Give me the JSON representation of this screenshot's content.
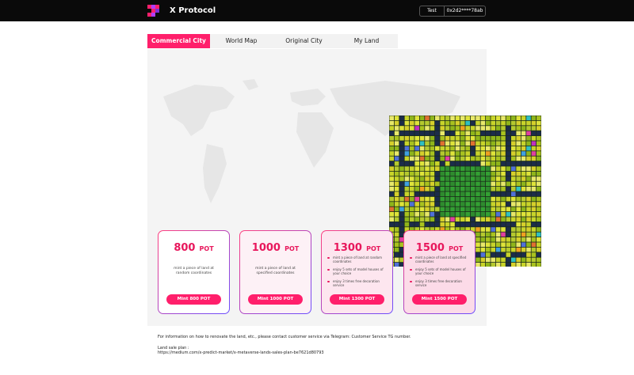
{
  "header": {
    "brand": "X Protocol",
    "network_label": "Test",
    "wallet_address": "0x2d2****78ab"
  },
  "tabs": [
    {
      "label": "Commercial City",
      "active": true
    },
    {
      "label": "World Map",
      "active": false
    },
    {
      "label": "Original City",
      "active": false
    },
    {
      "label": "My Land",
      "active": false
    }
  ],
  "cards": [
    {
      "price": "800",
      "unit": "POT",
      "description": "mint a piece of land at random coordinates",
      "features": [],
      "button": "Mint 800 POT"
    },
    {
      "price": "1000",
      "unit": "POT",
      "description": "mint a piece of land at specified coordinates",
      "features": [],
      "button": "Mint 1000 POT"
    },
    {
      "price": "1300",
      "unit": "POT",
      "description": "",
      "features": [
        "mint a piece of land at random coordinates",
        "enjoy 5 sets of model houses of your choice",
        "enjoy 3 times free decoration service"
      ],
      "button": "Mint 1300 POT"
    },
    {
      "price": "1500",
      "unit": "POT",
      "description": "",
      "features": [
        "mint a piece of land at specified coordinates",
        "enjoy 5 sets of model houses of your choice",
        "enjoy 3 times free decoration service"
      ],
      "button": "Mint 1500 POT"
    }
  ],
  "footer": {
    "info": "For information on how to renovate the land, etc., please contact customer service via Telegram: Customer Service TG number.",
    "plan_label": "Land sale plan :",
    "plan_url": "https://medium.com/x-predict-market/x-metaverse-lands-sales-plan-be7621d80793"
  },
  "colors": {
    "accent": "#ff1f6b",
    "topbar": "#0a0a0a",
    "park_green": "#2e8b2e"
  }
}
